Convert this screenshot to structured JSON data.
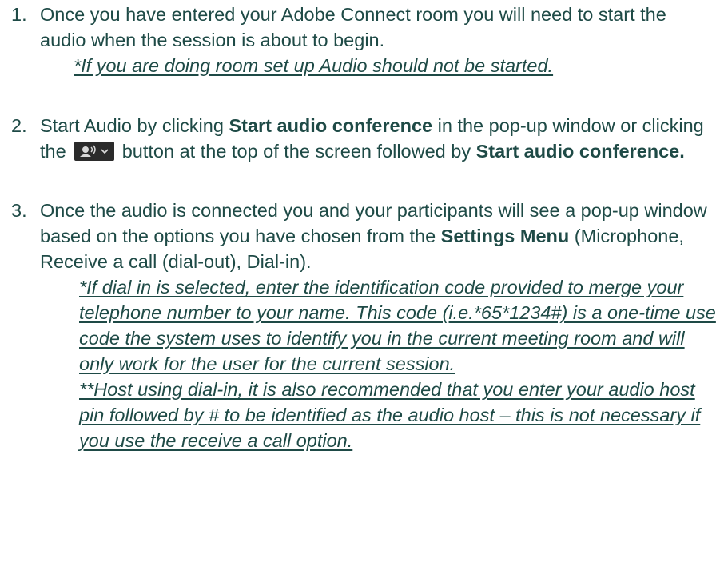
{
  "items": [
    {
      "number": "1.",
      "text": "Once you have entered your Adobe Connect room you will need to start the audio when the session is about to begin.",
      "note": "*If you are doing room set up Audio should not be started."
    },
    {
      "number": "2.",
      "text_a": "Start Audio by clicking ",
      "bold_a": "Start audio conference",
      "text_b": " in the pop-up window or clicking the ",
      "button_icon": "audio-speaker-dropdown-icon",
      "text_c": " button at the top of the screen followed by ",
      "bold_b": "Start audio conference."
    },
    {
      "number": "3.",
      "text_a": "Once the audio is connected you and your participants will see a pop-up window based on the options you have chosen from the ",
      "bold_a": "Settings Menu",
      "text_b": " (Microphone, Receive a call (dial-out), Dial-in).",
      "note_1": "*If dial in is selected, enter the identification code provided to merge your telephone number to your name. This code (i.e.*65*1234#) is a one-time use code the system uses to identify you in the current meeting room and will only work for the user for the current session.",
      "note_2": "**Host using dial-in, it is also recommended that you enter your audio host pin followed by # to be identified as the audio host – this is not necessary if you use the receive a call option."
    }
  ],
  "colors": {
    "text": "#1e4a46",
    "button_bg": "#2b2b2b",
    "button_icon": "#d8d8d8"
  }
}
